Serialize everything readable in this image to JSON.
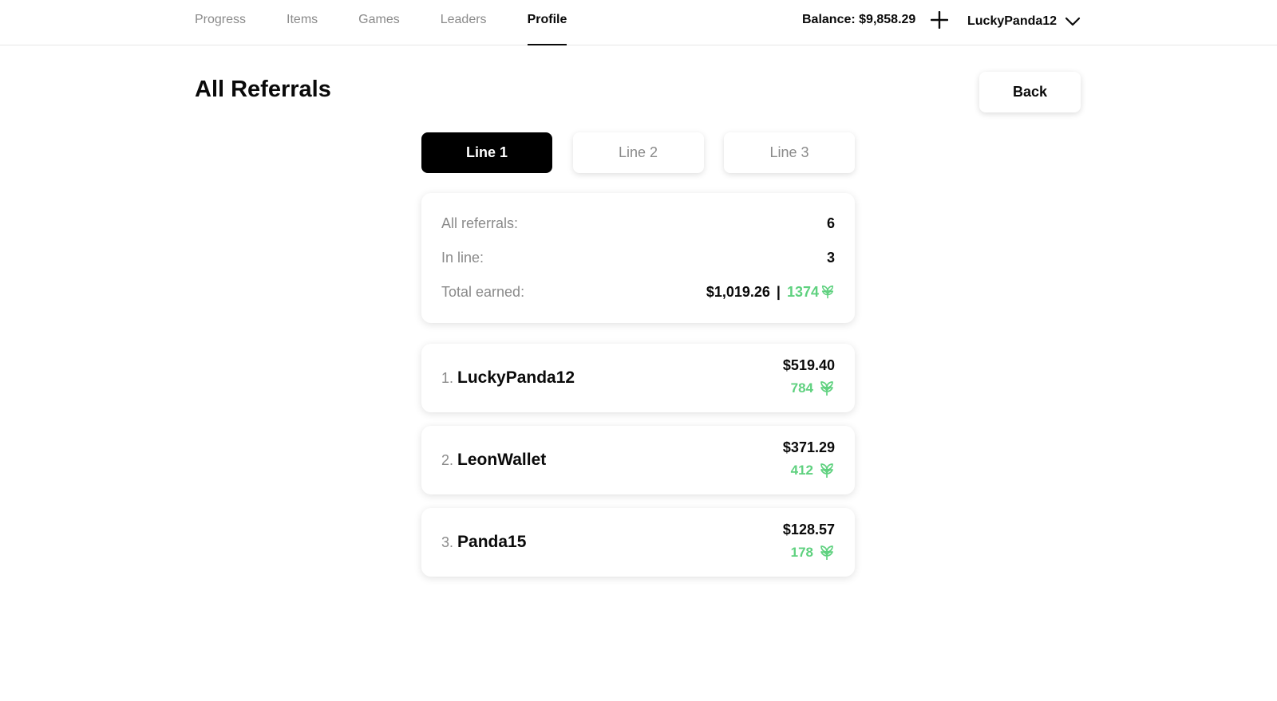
{
  "nav": {
    "items": [
      {
        "label": "Progress",
        "active": false
      },
      {
        "label": "Items",
        "active": false
      },
      {
        "label": "Games",
        "active": false
      },
      {
        "label": "Leaders",
        "active": false
      },
      {
        "label": "Profile",
        "active": true
      }
    ],
    "balance": "Balance: $9,858.29",
    "add_icon": "plus-icon",
    "username": "LuckyPanda12",
    "menu_icon": "chevron-down-icon"
  },
  "page": {
    "title": "All Referrals",
    "back_label": "Back"
  },
  "tabs": [
    {
      "label": "Line 1",
      "active": true
    },
    {
      "label": "Line 2",
      "active": false
    },
    {
      "label": "Line 3",
      "active": false
    }
  ],
  "summary": {
    "all_referrals_label": "All referrals:",
    "all_referrals_value": "6",
    "in_line_label": "In line:",
    "in_line_value": "3",
    "total_earned_label": "Total earned:",
    "total_earned_usd": "$1,019.26",
    "separator": "|",
    "total_earned_points": "1374",
    "points_icon": "leaf-icon"
  },
  "referrals": [
    {
      "index": "1.",
      "name": "LuckyPanda12",
      "usd": "$519.40",
      "points": "784"
    },
    {
      "index": "2.",
      "name": "LeonWallet",
      "usd": "$371.29",
      "points": "412"
    },
    {
      "index": "3.",
      "name": "Panda15",
      "usd": "$128.57",
      "points": "178"
    }
  ],
  "colors": {
    "accent_green": "#5fd17f",
    "muted_text": "#8a8a8a",
    "primary": "#000000"
  }
}
